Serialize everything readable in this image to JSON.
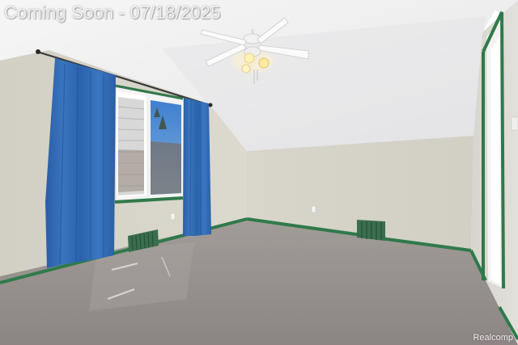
{
  "watermark": {
    "text": "Coming Soon - 07/18/2025"
  },
  "brand": {
    "text": "Realcomp"
  },
  "colors": {
    "ceiling": "#efeeee",
    "wall": "#d9d6cc",
    "trim": "#2f7a4a",
    "carpet": "#928b89",
    "curtain": "#2f68b0",
    "sky": "#4a86d0"
  }
}
